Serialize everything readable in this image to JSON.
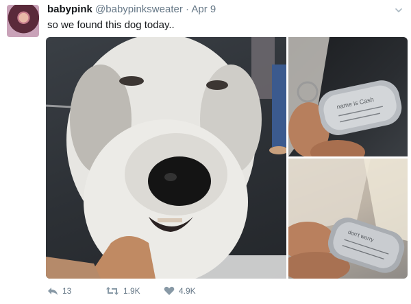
{
  "tweet": {
    "display_name": "babypink",
    "handle": "@babypinksweater",
    "separator": "·",
    "date": "Apr 9",
    "text": "so we found this dog today.."
  },
  "icons": {
    "more": "chevron-down-icon",
    "reply": "reply-icon",
    "retweet": "retweet-icon",
    "like": "heart-icon"
  },
  "actions": {
    "reply_count": "13",
    "retweet_count": "1.9K",
    "like_count": "4.9K"
  },
  "media": {
    "tag_top": "name is Cash",
    "tag_bottom": "don't worry"
  },
  "colors": {
    "name": "#14171a",
    "secondary": "#657786",
    "background": "#ffffff"
  }
}
